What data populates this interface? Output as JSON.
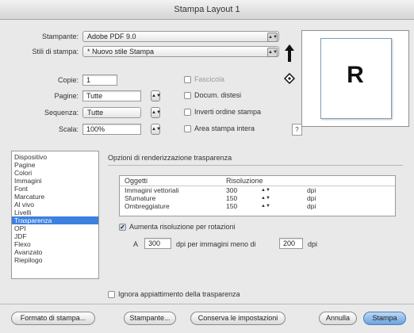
{
  "window": {
    "title": "Stampa Layout 1"
  },
  "printer": {
    "label": "Stampante:",
    "value": "Adobe PDF 9.0"
  },
  "print_style": {
    "label": "Stili di stampa:",
    "value": "* Nuovo stile Stampa"
  },
  "copies": {
    "label": "Copie:",
    "value": "1"
  },
  "pages": {
    "label": "Pagine:",
    "value": "Tutte"
  },
  "sequence": {
    "label": "Sequenza:",
    "value": "Tutte"
  },
  "scale": {
    "label": "Scala:",
    "value": "100%"
  },
  "options": {
    "collate": "Fascicola",
    "spreads": "Docum. distesi",
    "reverse": "Inverti ordine stampa",
    "fit": "Area stampa intera"
  },
  "help_label": "?",
  "preview_letter": "R",
  "categories": [
    {
      "label": "Dispositivo"
    },
    {
      "label": "Pagine"
    },
    {
      "label": "Colori"
    },
    {
      "label": "Immagini"
    },
    {
      "label": "Font"
    },
    {
      "label": "Marcature"
    },
    {
      "label": "Al vivo"
    },
    {
      "label": "Livelli"
    },
    {
      "label": "Trasparenza"
    },
    {
      "label": "OPI"
    },
    {
      "label": "JDF"
    },
    {
      "label": "Flexo"
    },
    {
      "label": "Avanzato"
    },
    {
      "label": "Riepilogo"
    }
  ],
  "section_title": "Opzioni di renderizzazione trasparenza",
  "table": {
    "col_objects": "Oggetti",
    "col_resolution": "Risoluzione",
    "rows": [
      {
        "object": "Immagini vettoriali",
        "resolution": "300",
        "unit": "dpi"
      },
      {
        "object": "Sfumature",
        "resolution": "150",
        "unit": "dpi"
      },
      {
        "object": "Ombreggiature",
        "resolution": "150",
        "unit": "dpi"
      }
    ]
  },
  "rotation": {
    "checkbox_label": "Aumenta risoluzione per rotazioni",
    "prefix": "A",
    "value_a": "300",
    "middle": "dpi per immagini meno di",
    "value_b": "200",
    "suffix": "dpi"
  },
  "ignore_flattening": "Ignora appiattimento della trasparenza",
  "buttons": {
    "page_setup": "Formato di stampa...",
    "printer": "Stampante...",
    "save_settings": "Conserva le impostazioni",
    "cancel": "Annulla",
    "print": "Stampa"
  }
}
